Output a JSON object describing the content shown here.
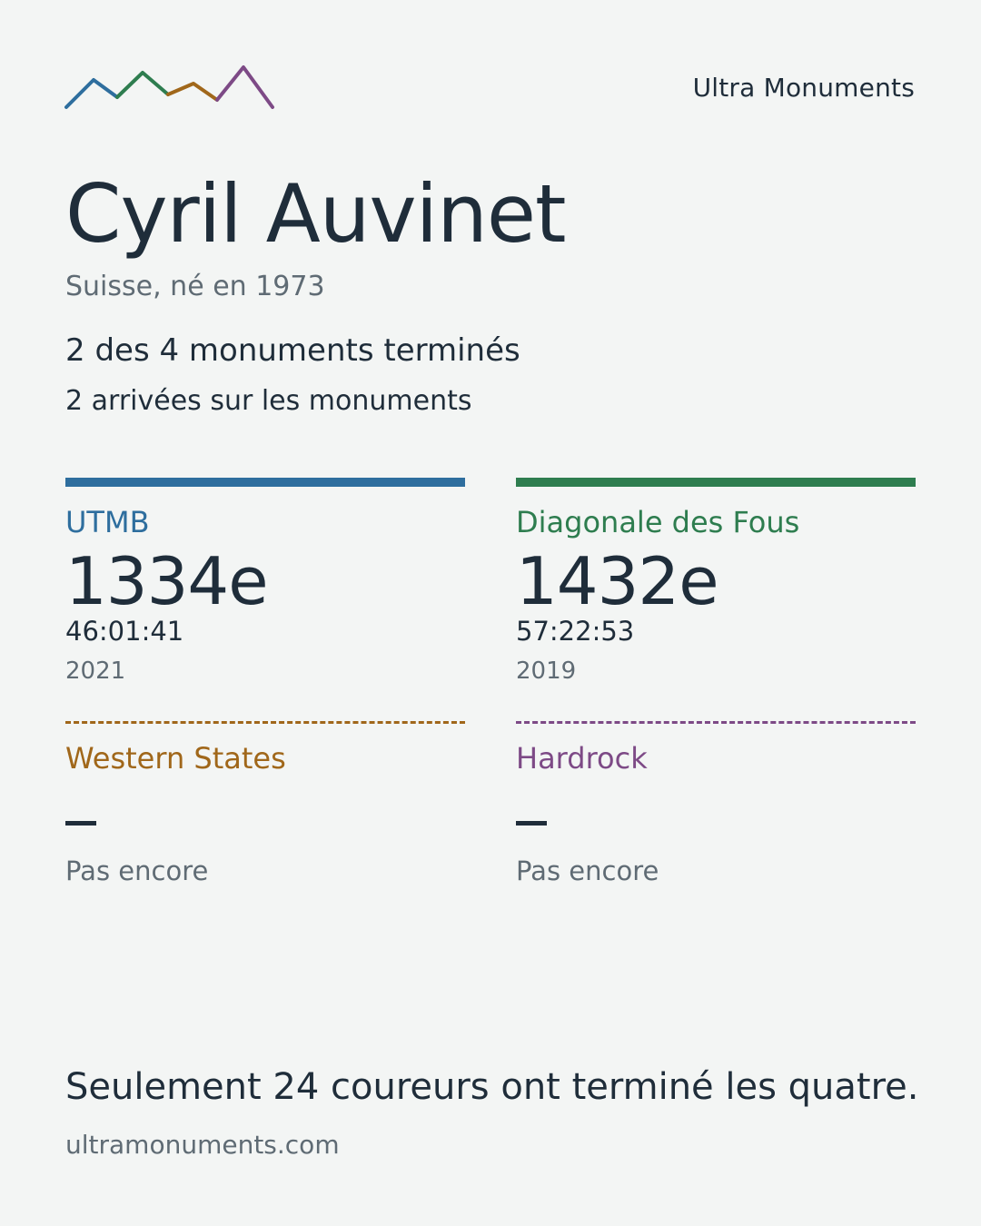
{
  "header": {
    "logo_name": "mountain-line-logo",
    "brand": "Ultra Monuments"
  },
  "runner": {
    "name": "Cyril Auvinet",
    "meta": "Suisse, né en 1973",
    "summary_completed": "2 des 4 monuments terminés",
    "summary_finishes": "2 arrivées sur les monuments"
  },
  "races": [
    {
      "name": "UTMB",
      "color": "#2e6e9e",
      "finished": true,
      "rank": "1334e",
      "time": "46:01:41",
      "year": "2021"
    },
    {
      "name": "Diagonale des Fous",
      "color": "#2e7d4f",
      "finished": true,
      "rank": "1432e",
      "time": "57:22:53",
      "year": "2019"
    },
    {
      "name": "Western States",
      "color": "#a0671a",
      "finished": false,
      "rank": "–",
      "status": "Pas encore"
    },
    {
      "name": "Hardrock",
      "color": "#7d4a86",
      "finished": false,
      "rank": "–",
      "status": "Pas encore"
    }
  ],
  "footer": {
    "tagline": "Seulement 24 coureurs ont terminé les quatre.",
    "url": "ultramonuments.com"
  }
}
